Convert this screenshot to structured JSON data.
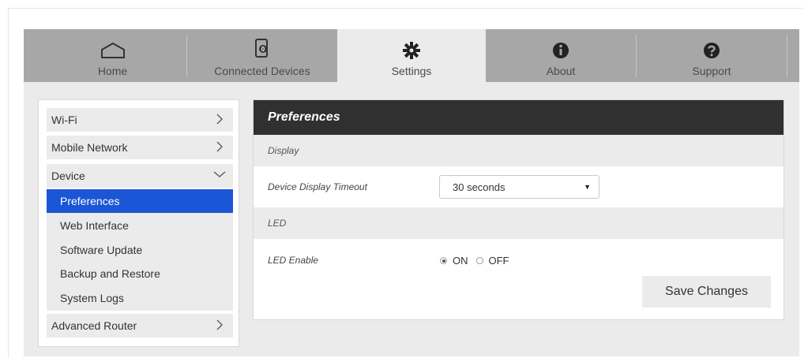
{
  "tabs": [
    {
      "label": "Home",
      "icon": "home-icon"
    },
    {
      "label": "Connected Devices",
      "icon": "connected-devices-icon"
    },
    {
      "label": "Settings",
      "icon": "gear-icon",
      "active": true
    },
    {
      "label": "About",
      "icon": "info-icon"
    },
    {
      "label": "Support",
      "icon": "help-icon"
    }
  ],
  "sidebar": {
    "items": [
      {
        "label": "Wi-Fi"
      },
      {
        "label": "Mobile Network"
      },
      {
        "label": "Device",
        "expanded": true
      },
      {
        "label": "Advanced Router"
      }
    ],
    "device_sub": [
      {
        "label": "Preferences",
        "active": true
      },
      {
        "label": "Web Interface"
      },
      {
        "label": "Software Update"
      },
      {
        "label": "Backup and Restore"
      },
      {
        "label": "System Logs"
      }
    ]
  },
  "panel": {
    "title": "Preferences",
    "display_section": "Display",
    "timeout_label": "Device Display Timeout",
    "timeout_value": "30 seconds",
    "led_section": "LED",
    "led_label": "LED Enable",
    "led_on": "ON",
    "led_off": "OFF",
    "led_selected": "ON",
    "save_label": "Save Changes"
  },
  "colors": {
    "tab_bar": "#a7a7a7",
    "active_tab": "#ebebeb",
    "header_bg": "#303030",
    "selected_item": "#1a56d6"
  }
}
